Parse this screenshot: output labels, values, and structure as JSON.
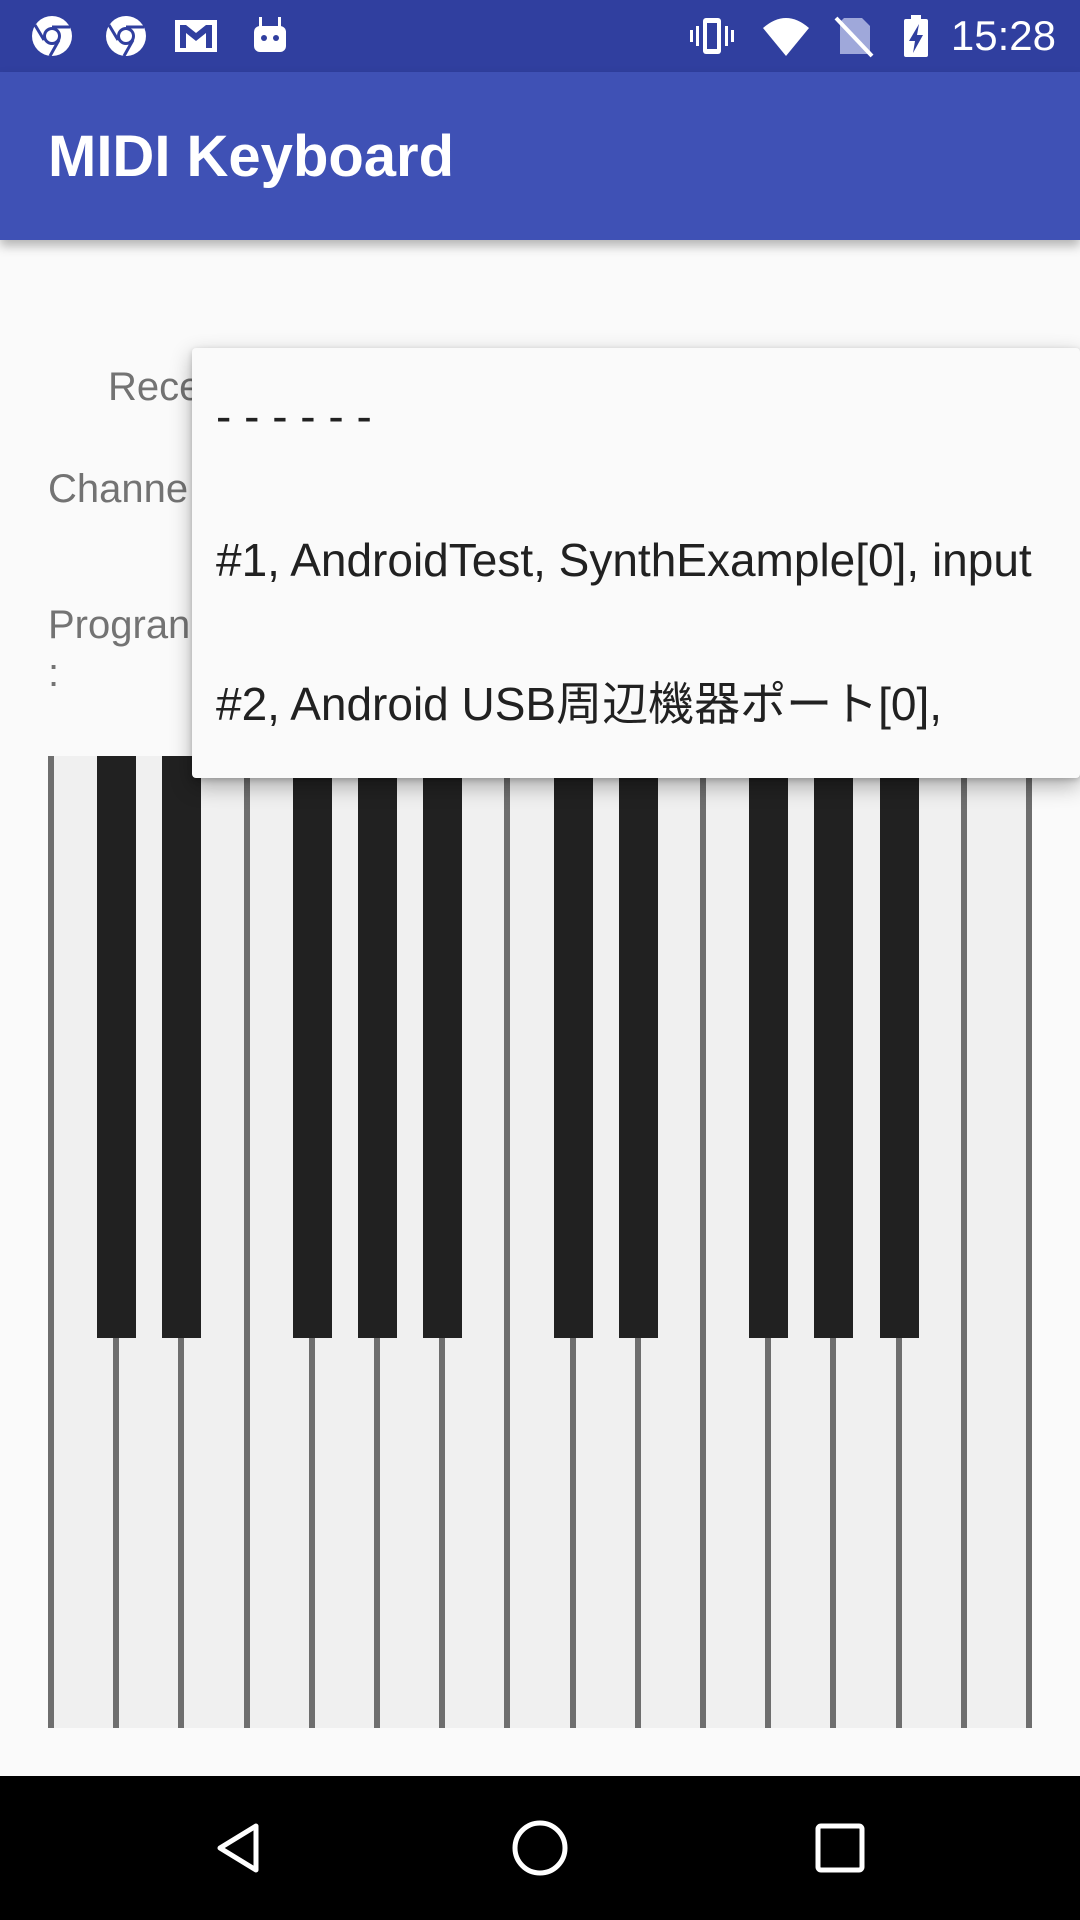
{
  "status_bar": {
    "time": "15:28",
    "icons": [
      "chrome-icon",
      "chrome-icon",
      "gmail-icon",
      "android-icon",
      "vibrate-icon",
      "wifi-icon",
      "no-sim-icon",
      "battery-charging-icon"
    ]
  },
  "app_bar": {
    "title": "MIDI Keyboard"
  },
  "form": {
    "receiver_label": "Rece",
    "channel_label": "Channe",
    "program_label": "Progran",
    "program_colon": ":"
  },
  "dropdown": {
    "items": [
      {
        "label": "- - - - - -"
      },
      {
        "label": "#1, AndroidTest, SynthExample[0], input"
      },
      {
        "label": "#2, Android USB周辺機器ポート[0],"
      }
    ]
  },
  "keyboard": {
    "white_keys": 15,
    "black_keys": 10
  },
  "nav_bar": {
    "buttons": [
      "back-icon",
      "home-icon",
      "recents-icon"
    ]
  },
  "colors": {
    "status_bar": "#303f9f",
    "app_bar": "#3f51b5",
    "background": "#fafafa",
    "black_key": "#212121",
    "white_key": "#f0f0f0",
    "key_separator": "#6e6e6e"
  }
}
